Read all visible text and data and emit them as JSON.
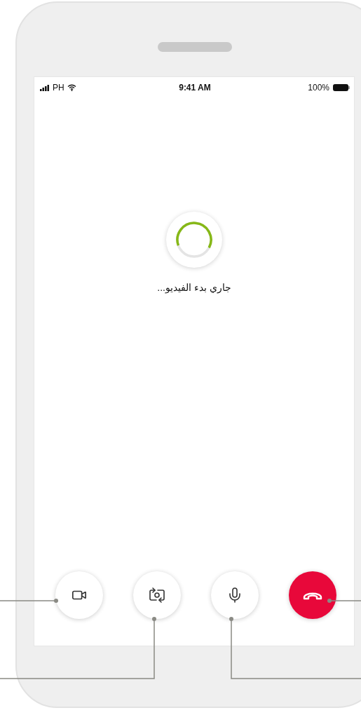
{
  "status_bar": {
    "carrier": "PH",
    "time": "9:41 AM",
    "battery": "100%"
  },
  "loading_text": "جاري بدء الفيديو...",
  "controls": [
    {
      "kind": "video"
    },
    {
      "kind": "flip-camera"
    },
    {
      "kind": "microphone"
    },
    {
      "kind": "end-call"
    }
  ]
}
